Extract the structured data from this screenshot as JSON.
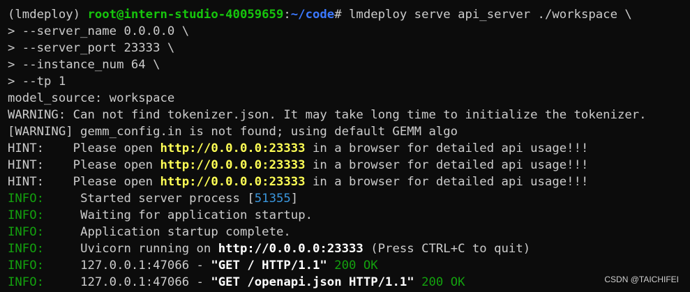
{
  "prompt": {
    "env": "(lmdeploy) ",
    "user_host": "root@intern-studio-40059659",
    "colon": ":",
    "path": "~/code",
    "symbol": "# ",
    "command": "lmdeploy serve api_server ./workspace \\"
  },
  "continuations": [
    "> --server_name 0.0.0.0 \\",
    "> --server_port 23333 \\",
    "> --instance_num 64 \\",
    "> --tp 1"
  ],
  "messages": [
    "model_source: workspace",
    "WARNING: Can not find tokenizer.json. It may take long time to initialize the tokenizer.",
    "[WARNING] gemm_config.in is not found; using default GEMM algo"
  ],
  "hints": {
    "prefix": "HINT:    Please open ",
    "url": "http://0.0.0.0:23333",
    "suffix": " in a browser for detailed api usage!!!"
  },
  "info": {
    "label": "INFO:",
    "spacer": "     ",
    "started_prefix": "Started server process [",
    "pid": "51355",
    "started_suffix": "]",
    "waiting": "Waiting for application startup.",
    "complete": "Application startup complete.",
    "uvicorn_prefix": "Uvicorn running on ",
    "uvicorn_url": "http://0.0.0.0:23333",
    "uvicorn_suffix": " (Press CTRL+C to quit)",
    "req1_prefix": "127.0.0.1:47066 - ",
    "req1_method": "\"GET / HTTP/1.1\"",
    "req1_status": " 200 OK",
    "req2_prefix": "127.0.0.1:47066 - ",
    "req2_method": "\"GET /openapi.json HTTP/1.1\"",
    "req2_status": " 200 OK"
  },
  "watermark": "CSDN @TAICHIFEI",
  "colors": {
    "background": "#0c0c0c",
    "foreground": "#cccccc",
    "prompt_user": "#16c60c",
    "prompt_path": "#3b78ff",
    "url_highlight": "#ffff55",
    "pid": "#3a96dd",
    "info": "#13a10e"
  }
}
